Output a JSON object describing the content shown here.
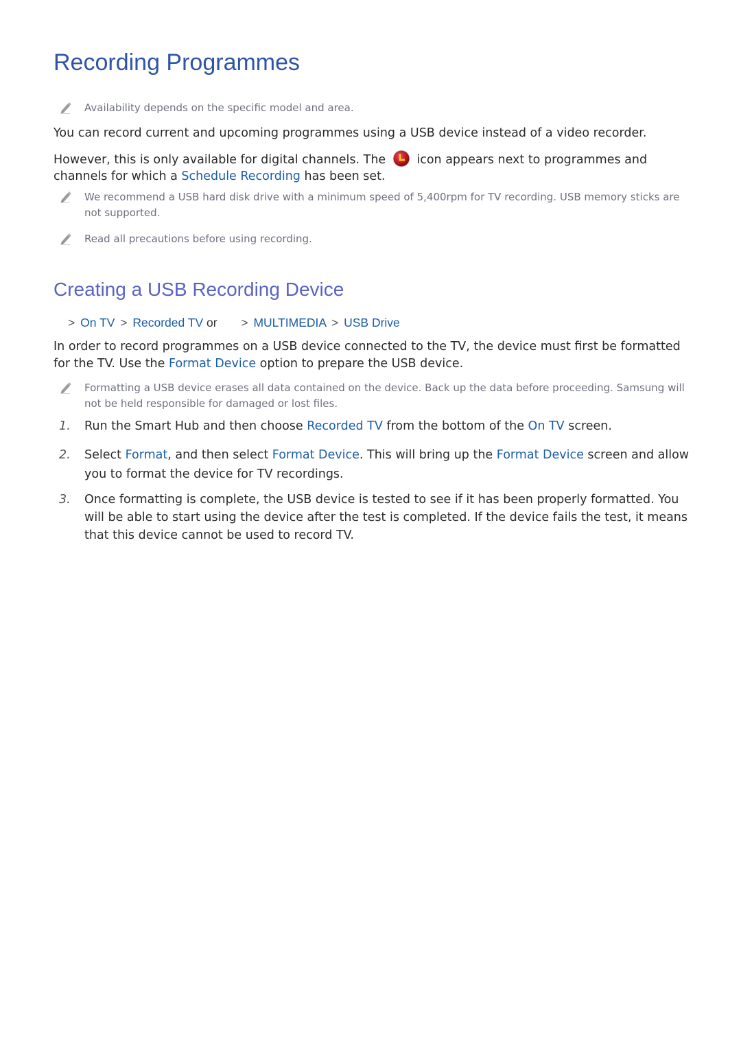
{
  "title": "Recording Programmes",
  "notes_top": [
    {
      "text": "Availability depends on the specific model and area."
    }
  ],
  "intro": {
    "p1": "You can record current and upcoming programmes using a USB device instead of a video recorder.",
    "p2_a": "However, this is only available for digital channels. The",
    "p2_icon": "schedule-recording-icon",
    "p2_b": "icon appears next to programmes and channels for which a",
    "p2_link": "Schedule Recording",
    "p2_c": "has been set."
  },
  "notes_mid": [
    {
      "text": "We recommend a USB hard disk drive with a minimum speed of 5,400rpm for TV recording. USB memory sticks are not supported."
    },
    {
      "text": "Read all precautions before using recording."
    }
  ],
  "section": {
    "heading": "Creating a USB Recording Device",
    "breadcrumb": {
      "path1": [
        "On TV",
        "Recorded TV"
      ],
      "or": "or",
      "path2": [
        "MULTIMEDIA",
        "USB Drive"
      ]
    },
    "para_a": "In order to record programmes on a USB device connected to the TV, the device must first be formatted for the TV. Use the",
    "para_link": "Format Device",
    "para_b": "option to prepare the USB device.",
    "note": "Formatting a USB device erases all data contained on the device. Back up the data before proceeding. Samsung will not be held responsible for damaged or lost files.",
    "steps": [
      {
        "num": "1.",
        "parts": [
          "Run the Smart Hub and then choose ",
          "Recorded TV",
          " from the bottom of the ",
          "On TV",
          " screen."
        ]
      },
      {
        "num": "2.",
        "parts": [
          "Select ",
          "Format",
          ", and then select ",
          "Format Device",
          ". This will bring up the ",
          "Format Device",
          " screen and allow you to format the device for TV recordings."
        ]
      },
      {
        "num": "3.",
        "parts": [
          "Once formatting is complete, the USB device is tested to see if it has been properly formatted. You will be able to start using the device after the test is completed. If the device fails the test, it means that this device cannot be used to record TV."
        ]
      }
    ]
  },
  "colors": {
    "title": "#2f54a6",
    "heading": "#5a63c2",
    "link": "#1a5ca8",
    "note_text": "#6e7080",
    "icon_red": "#c0182a",
    "icon_yellow": "#f5c518"
  }
}
